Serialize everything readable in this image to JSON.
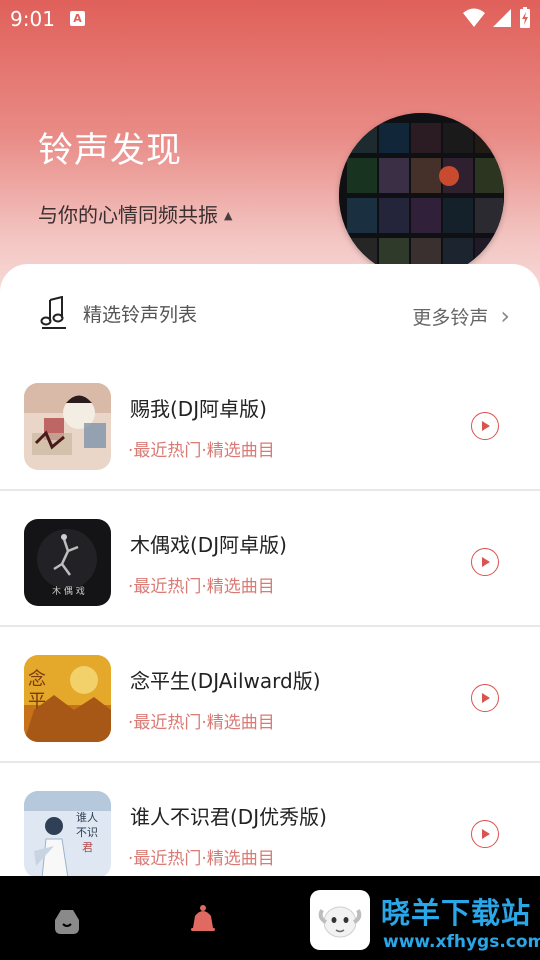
{
  "status_bar": {
    "time": "9:01",
    "notification_badge": "A"
  },
  "hero": {
    "title": "铃声发现",
    "subtitle": "与你的心情同频共振",
    "subtitle_caret": "▲"
  },
  "section": {
    "title": "精选铃声列表",
    "more_label": "更多铃声",
    "more_chevron": "›"
  },
  "ringtones": [
    {
      "title": "赐我(DJ阿卓版)",
      "tag": "·最近热门·精选曲目",
      "cover_colors": [
        "#e9d6c8",
        "#b24a4a",
        "#6d8aa5"
      ]
    },
    {
      "title": "木偶戏(DJ阿卓版)",
      "tag": "·最近热门·精选曲目",
      "cover_colors": [
        "#141416",
        "#2a2a2e",
        "#bdbdbd"
      ]
    },
    {
      "title": "念平生(DJAilward版)",
      "tag": "·最近热门·精选曲目",
      "cover_colors": [
        "#e4a92a",
        "#c7721a",
        "#f2d06a"
      ]
    },
    {
      "title": "谁人不识君(DJ优秀版)",
      "tag": "·最近热门·精选曲目",
      "cover_colors": [
        "#dfe8f2",
        "#9bb3cc",
        "#2f3f55"
      ]
    }
  ],
  "bottom_nav": {
    "items": [
      "home-icon",
      "bell-icon"
    ]
  },
  "watermark": {
    "name": "晓羊下载站",
    "url": "www.xfhygs.com"
  },
  "colors": {
    "accent": "#d9534f",
    "tag": "#d97a74",
    "header_top": "#e0605a"
  }
}
